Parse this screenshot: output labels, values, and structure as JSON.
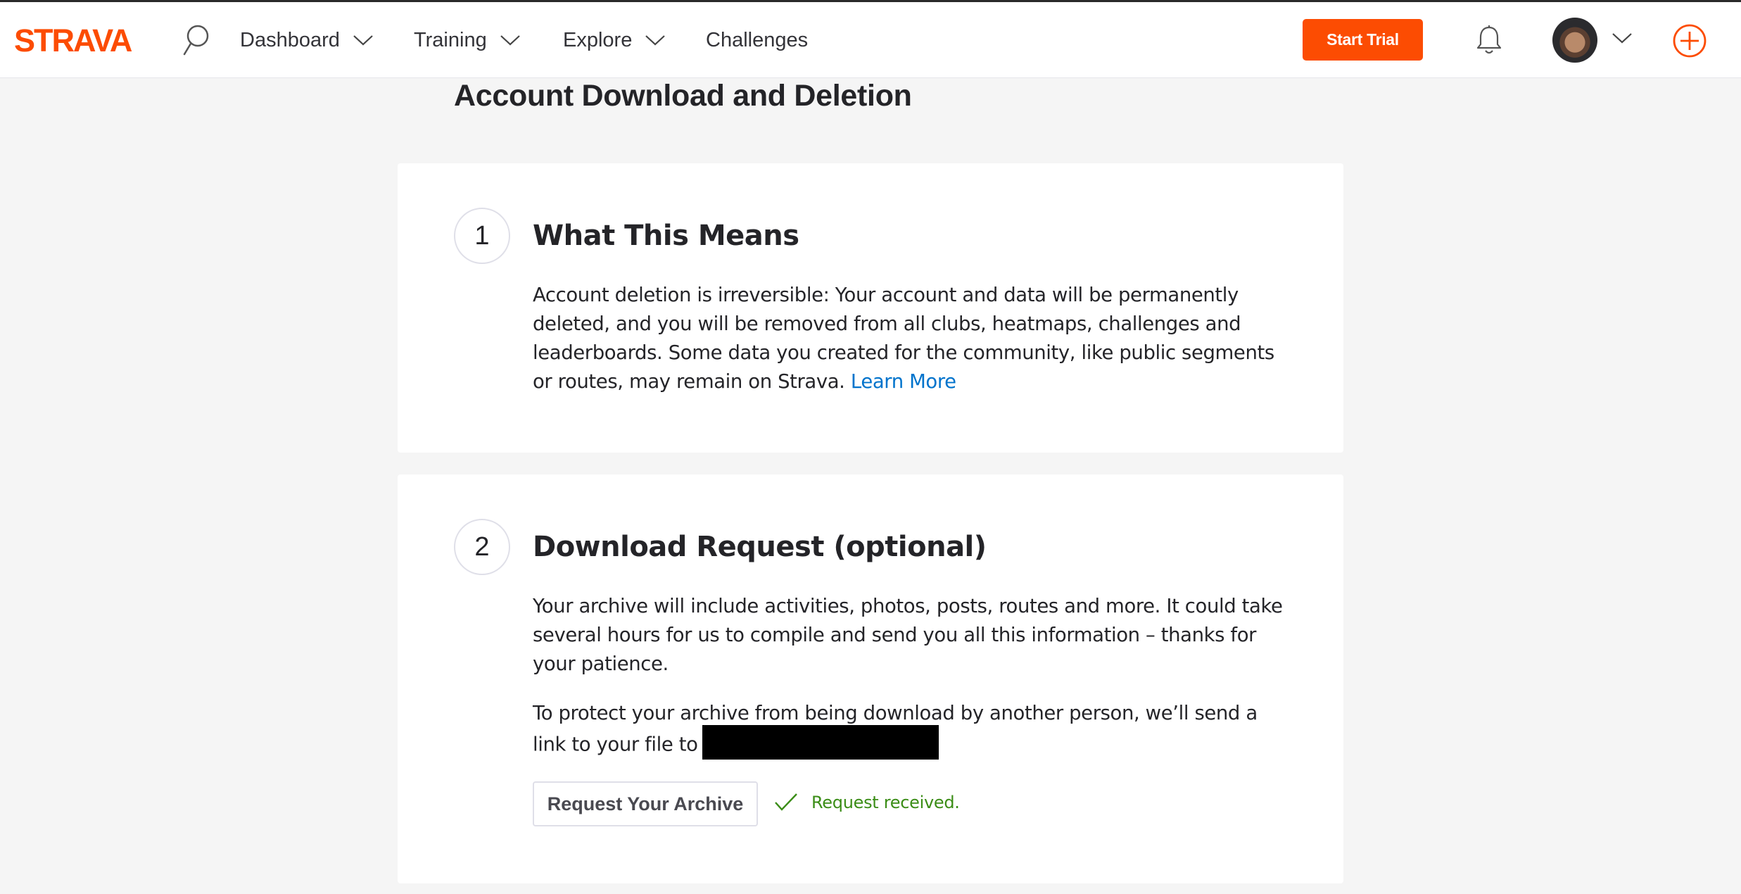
{
  "nav": {
    "logo_text": "STRAVA",
    "items": [
      {
        "label": "Dashboard",
        "has_dropdown": true
      },
      {
        "label": "Training",
        "has_dropdown": true
      },
      {
        "label": "Explore",
        "has_dropdown": true
      },
      {
        "label": "Challenges",
        "has_dropdown": false
      }
    ],
    "start_trial": "Start Trial"
  },
  "page": {
    "title": "Account Download and Deletion"
  },
  "steps": [
    {
      "number": "1",
      "title": "What This Means",
      "body": "Account deletion is irreversible: Your account and data will be permanently deleted, and you will be removed from all clubs, heatmaps, challenges and leaderboards. Some data you created for the community, like public segments or routes, may remain on Strava.",
      "link": "Learn More"
    },
    {
      "number": "2",
      "title": "Download Request (optional)",
      "body": "Your archive will include activities, photos, posts, routes and more. It could take several hours for us to compile and send you all this information – thanks for your patience.",
      "body2": "To protect your archive from being download by another person, we’ll send a link to your file to",
      "button": "Request Your Archive",
      "status": "Request received."
    }
  ],
  "colors": {
    "brand": "#fc4c02",
    "link": "#0073cc",
    "success": "#3b8d17",
    "background": "#f5f5f5"
  }
}
